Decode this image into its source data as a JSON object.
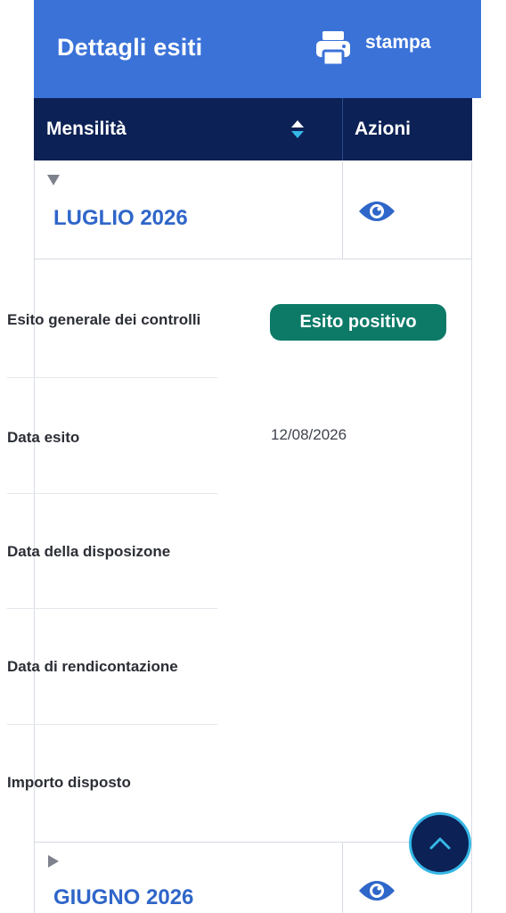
{
  "header": {
    "title": "Dettagli esiti",
    "print_label": "stampa",
    "print_icon": "printer-icon"
  },
  "table": {
    "col_month": "Mensilità",
    "col_actions": "Azioni",
    "sort_icon": "sort-icon"
  },
  "months": [
    {
      "label": "LUGLIO 2026",
      "expanded": true
    },
    {
      "label": "GIUGNO 2026",
      "expanded": false
    }
  ],
  "details": {
    "esito_label": "Esito generale dei controlli",
    "esito_value": "Esito positivo",
    "data_esito_label": "Data esito",
    "data_esito_value": "12/08/2026",
    "data_disposizione_label": "Data della disposizone",
    "data_rendicontazione_label": "Data di rendicontazione",
    "importo_label": "Importo disposto"
  },
  "colors": {
    "header_bg": "#3a72d8",
    "table_header_bg": "#0c2155",
    "link_blue": "#2f66c9",
    "badge_green": "#0d7a68",
    "to_top_border": "#35b7e6"
  }
}
